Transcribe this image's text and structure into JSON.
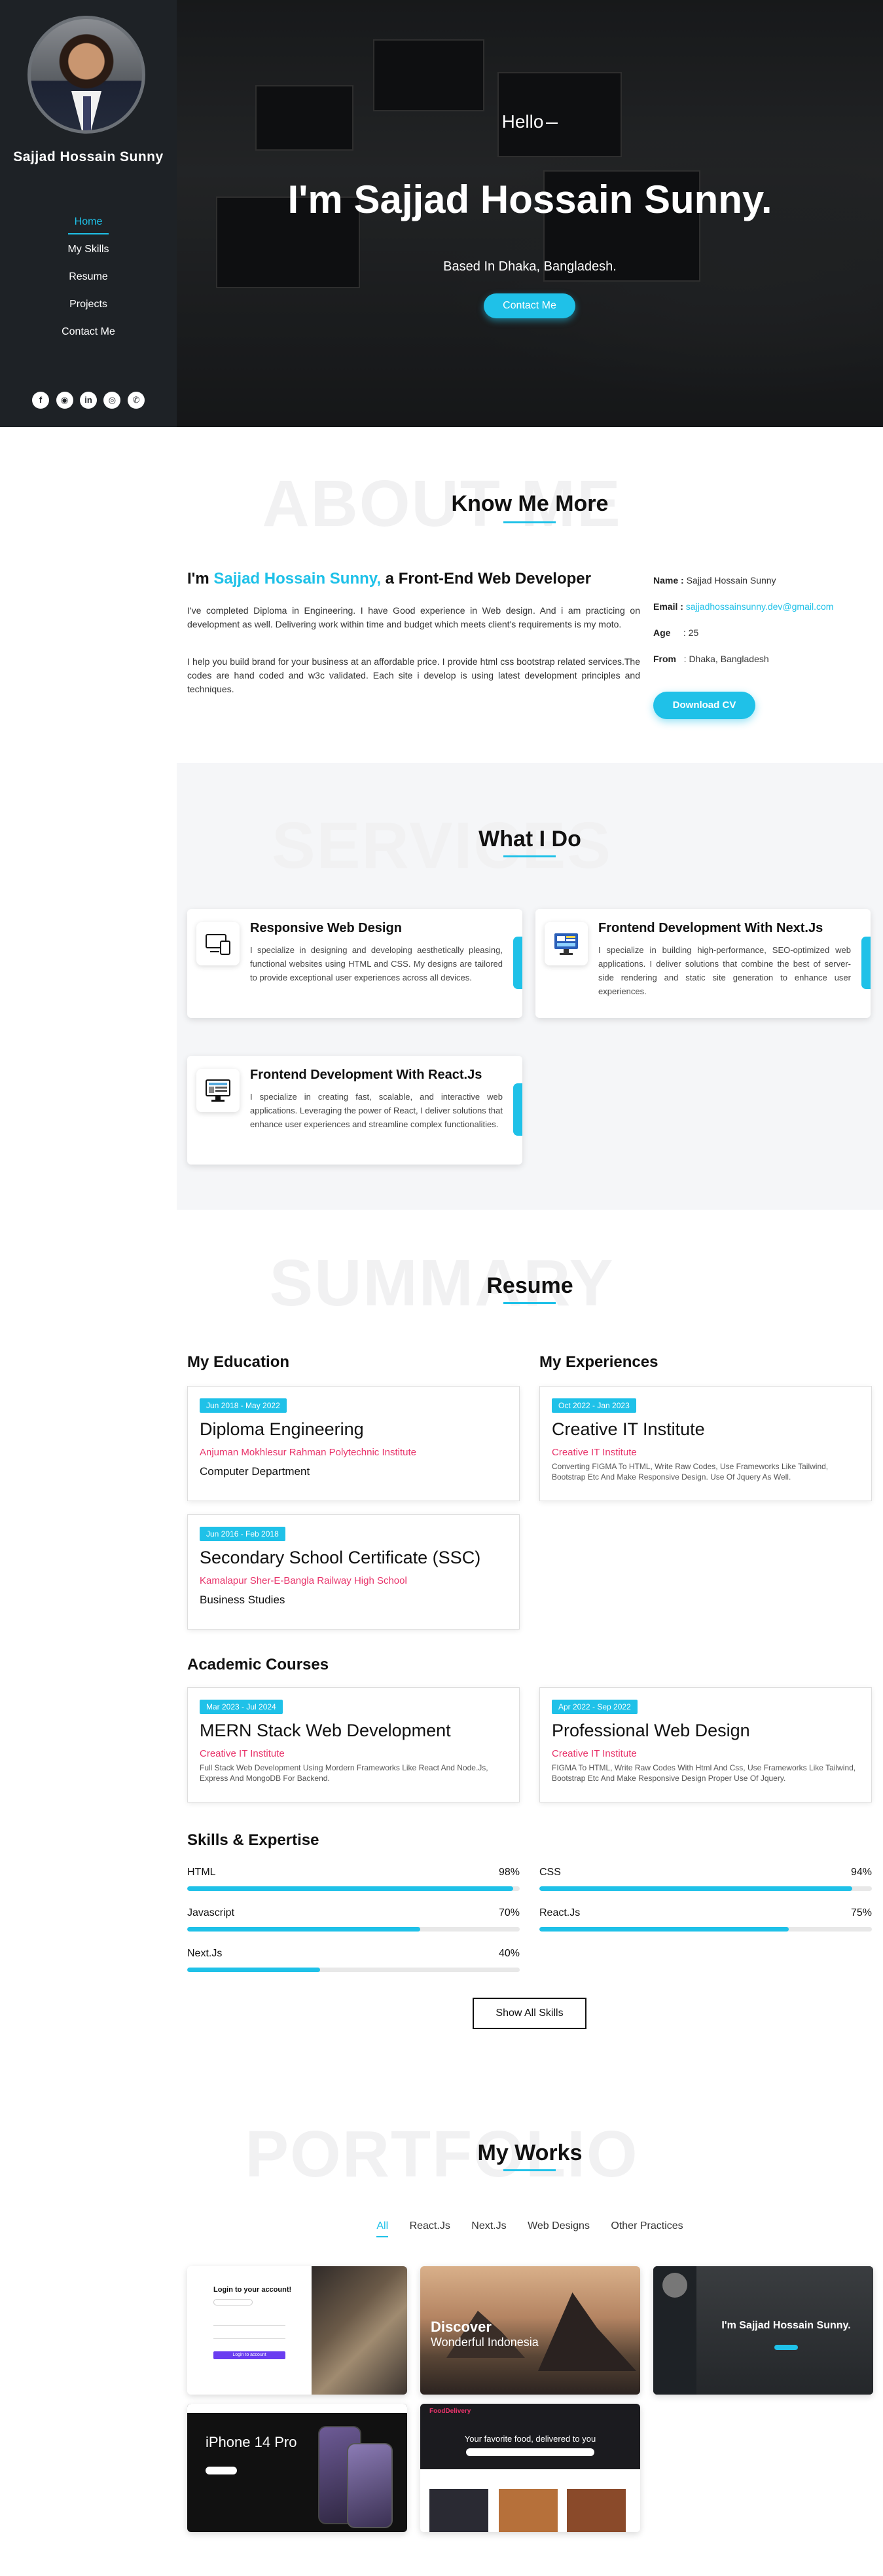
{
  "sidebar": {
    "name": "Sajjad Hossain Sunny",
    "nav": [
      {
        "label": "Home"
      },
      {
        "label": "My Skills"
      },
      {
        "label": "Resume"
      },
      {
        "label": "Projects"
      },
      {
        "label": "Contact Me"
      }
    ],
    "socials": [
      {
        "icon": "facebook-icon",
        "glyph": "f"
      },
      {
        "icon": "github-icon",
        "glyph": "◉"
      },
      {
        "icon": "linkedin-icon",
        "glyph": "in"
      },
      {
        "icon": "instagram-icon",
        "glyph": "◎"
      },
      {
        "icon": "whatsapp-icon",
        "glyph": "✆"
      }
    ]
  },
  "hero": {
    "hello": "Hello",
    "title": "I'm Sajjad Hossain Sunny.",
    "subtitle": "Based In Dhaka, Bangladesh.",
    "button": "Contact Me"
  },
  "about": {
    "bg_text": "ABOUT ME",
    "title": "Know Me More",
    "head_prefix": "I'm ",
    "head_name": "Sajjad Hossain Sunny,",
    "head_suffix": " a Front-End Web Developer",
    "p1": "I've completed Diploma in Engineering. I have Good experience in Web design. And i am practicing on development as well. Delivering work within time and budget which meets client's requirements is my moto.",
    "p2": "I help you build brand for your business at an affordable price. I provide html css bootstrap related services.The codes are hand coded and w3c validated. Each site i develop is using latest development principles and techniques.",
    "info": [
      {
        "label": "Name :",
        "value": "Sajjad Hossain Sunny"
      },
      {
        "label": "Email :",
        "value": "sajjadhossainsunny.dev@gmail.com"
      },
      {
        "label": "Age",
        "value": ": 25"
      },
      {
        "label": "From",
        "value": ": Dhaka, Bangladesh"
      }
    ],
    "button": "Download CV"
  },
  "services": {
    "bg_text": "SERVICES",
    "title": "What I Do",
    "items": [
      {
        "icon": "responsive-devices-icon",
        "title": "Responsive Web Design",
        "desc": "I specialize in designing and developing aesthetically pleasing, functional websites using HTML and CSS. My designs are tailored to provide exceptional user experiences across all devices."
      },
      {
        "icon": "nextjs-monitor-icon",
        "title": "Frontend Development With Next.Js",
        "desc": "I specialize in building high-performance, SEO-optimized web applications. I deliver solutions that combine the best of server-side rendering and static site generation to enhance user experiences."
      },
      {
        "icon": "react-monitor-icon",
        "title": "Frontend Development With React.Js",
        "desc": "I specialize in creating fast, scalable, and interactive web applications. Leveraging the power of React, I deliver solutions that enhance user experiences and streamline complex functionalities."
      }
    ]
  },
  "resume": {
    "bg_text": "SUMMARY",
    "title": "Resume",
    "education_title": "My Education",
    "experience_title": "My Experiences",
    "education": [
      {
        "date": "Jun 2018 - May 2022",
        "title": "Diploma Engineering",
        "inst": "Anjuman Mokhlesur Rahman Polytechnic Institute",
        "dept": "Computer Department"
      },
      {
        "date": "Jun 2016 - Feb 2018",
        "title": "Secondary School Certificate (SSC)",
        "inst": "Kamalapur Sher-E-Bangla Railway High School",
        "dept": "Business Studies"
      }
    ],
    "experience": [
      {
        "date": "Oct 2022 - Jan 2023",
        "title": "Creative IT Institute",
        "inst": "Creative IT Institute",
        "desc": "Converting FIGMA To HTML, Write Raw Codes, Use Frameworks Like Tailwind, Bootstrap Etc And Make Responsive Design. Use Of Jquery As Well."
      }
    ],
    "courses_title": "Academic Courses",
    "courses": [
      {
        "date": "Mar 2023 - Jul 2024",
        "title": "MERN Stack Web Development",
        "inst": "Creative IT Institute",
        "desc": "Full Stack Web Development Using Mordern Frameworks Like React And Node.Js, Express And MongoDB For Backend."
      },
      {
        "date": "Apr 2022 - Sep 2022",
        "title": "Professional Web Design",
        "inst": "Creative IT Institute",
        "desc": "FIGMA To HTML, Write Raw Codes With Html And Css, Use Frameworks Like Tailwind, Bootstrap Etc And Make Responsive Design Proper Use Of Jquery."
      }
    ],
    "skills_title": "Skills & Expertise",
    "skills": [
      {
        "name": "HTML",
        "pct": "98%",
        "value": 98
      },
      {
        "name": "CSS",
        "pct": "94%",
        "value": 94
      },
      {
        "name": "Javascript",
        "pct": "70%",
        "value": 70
      },
      {
        "name": "React.Js",
        "pct": "75%",
        "value": 75
      },
      {
        "name": "Next.Js",
        "pct": "40%",
        "value": 40
      }
    ],
    "show_all": "Show All Skills"
  },
  "works": {
    "bg_text": "PORTFOLIO",
    "title": "My Works",
    "filters": [
      "All",
      "React.Js",
      "Next.Js",
      "Web Designs",
      "Other Practices"
    ],
    "thumbs": [
      {
        "name": "login-page-thumb",
        "t1": "Login to your account!",
        "t2": "Login to account"
      },
      {
        "name": "discover-indonesia-thumb",
        "t1": "Discover",
        "t2": "Wonderful Indonesia"
      },
      {
        "name": "portfolio-thumb",
        "t1": "I'm Sajjad Hossain Sunny."
      },
      {
        "name": "iphone-thumb",
        "t1": "iPhone 14 Pro"
      },
      {
        "name": "food-delivery-thumb",
        "t1": "FoodDelivery",
        "t2": "Your favorite food, delivered to you"
      }
    ]
  }
}
